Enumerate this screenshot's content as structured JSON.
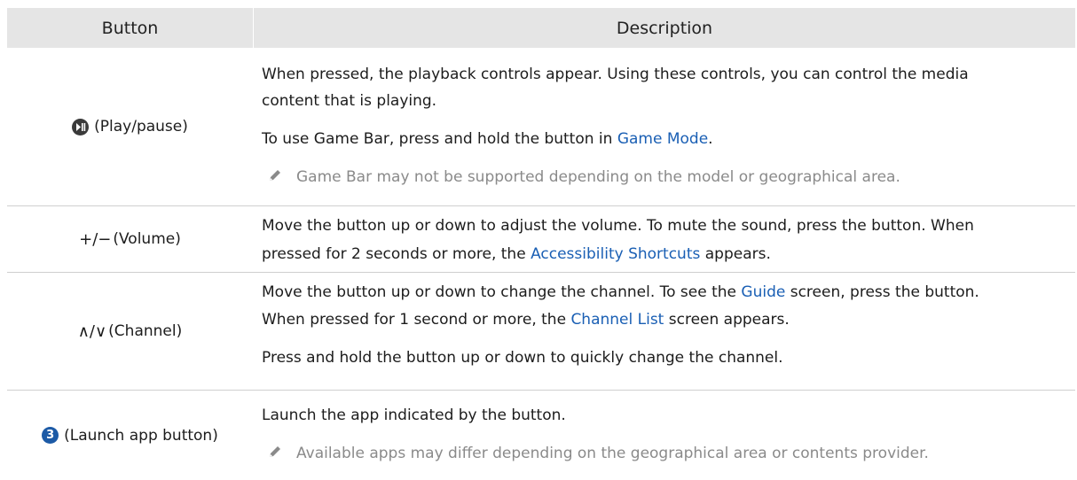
{
  "header": {
    "button_col": "Button",
    "description_col": "Description"
  },
  "rows": [
    {
      "button_label": "(Play/pause)",
      "icon": "play-pause-icon",
      "desc_1": "When pressed, the playback controls appear. Using these controls, you can control the media",
      "desc_1b": "content that is playing.",
      "desc_2_pre": "To use Game Bar, press and hold the button in ",
      "desc_2_link": "Game Mode",
      "desc_2_post": ".",
      "note": "Game Bar may not be supported depending on the model or geographical area."
    },
    {
      "button_symbol": "+/−",
      "button_label": "(Volume)",
      "desc_1": "Move the button up or down to adjust the volume. To mute the sound, press the button. When",
      "desc_2_pre": "pressed for 2 seconds or more, the ",
      "desc_2_link": "Accessibility Shortcuts",
      "desc_2_post": " appears."
    },
    {
      "button_symbol": "∧/∨",
      "button_label": "(Channel)",
      "desc_1_pre": "Move the button up or down to change the channel. To see the ",
      "desc_1_link": "Guide",
      "desc_1_post": " screen, press the button.",
      "desc_2_pre": "When pressed for 1 second or more, the ",
      "desc_2_link": "Channel List",
      "desc_2_post": " screen appears.",
      "desc_3": "Press and hold the button up or down to quickly change the channel."
    },
    {
      "button_badge": "3",
      "button_label": "(Launch app button)",
      "desc_1": "Launch the app indicated by the button.",
      "note": "Available apps may differ depending on the geographical area or contents provider."
    }
  ],
  "colors": {
    "header_bg": "#e5e5e5",
    "link": "#1a5fb4",
    "note_text": "#8a8a8a",
    "badge": "#1c5aa6"
  }
}
